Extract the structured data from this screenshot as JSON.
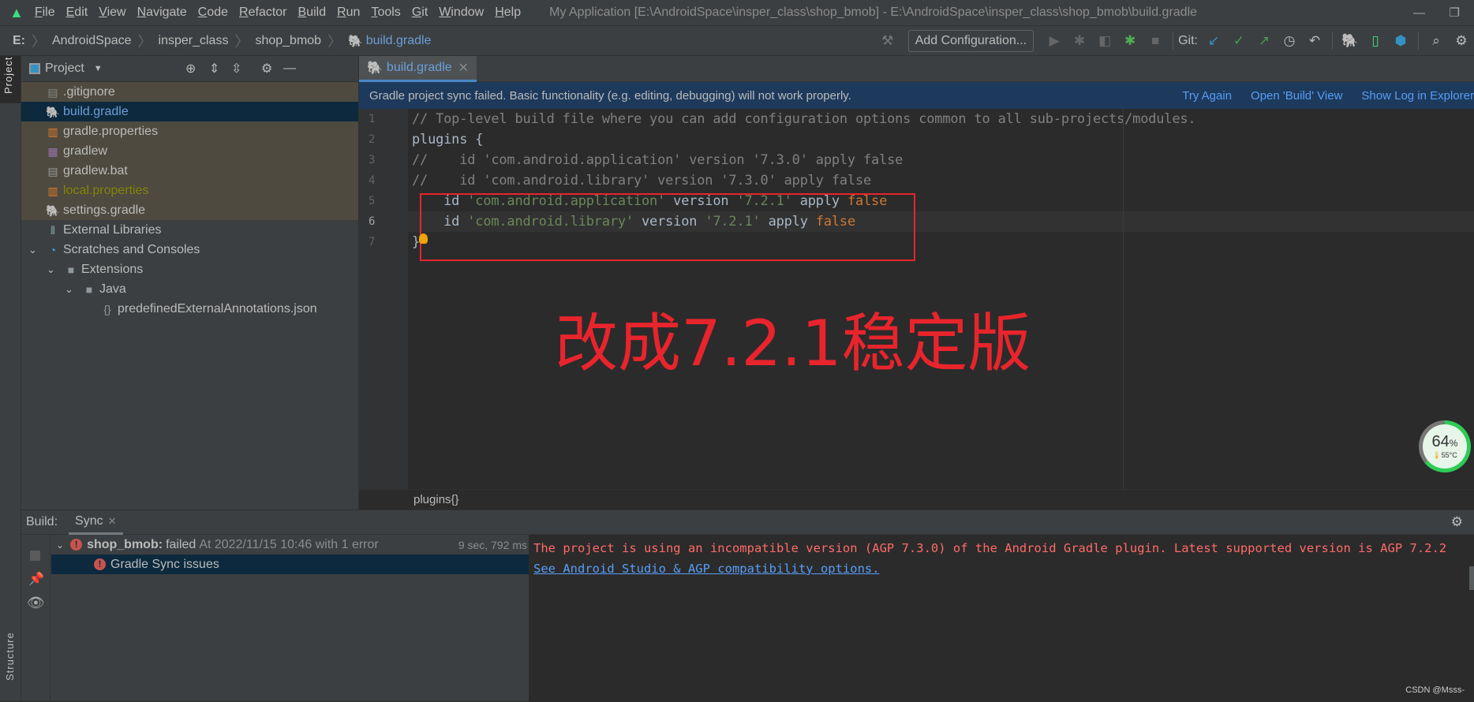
{
  "titlebar": {
    "menus": [
      "File",
      "Edit",
      "View",
      "Navigate",
      "Code",
      "Refactor",
      "Build",
      "Run",
      "Tools",
      "Git",
      "Window",
      "Help"
    ],
    "title": "My Application [E:\\AndroidSpace\\insper_class\\shop_bmob] - E:\\AndroidSpace\\insper_class\\shop_bmob\\build.gradle"
  },
  "navbar": {
    "breadcrumbs": [
      "E:",
      "AndroidSpace",
      "insper_class",
      "shop_bmob",
      "build.gradle"
    ],
    "add_config": "Add Configuration...",
    "git_label": "Git:"
  },
  "sidebar": {
    "project_tab": "Project",
    "structure_tab": "Structure"
  },
  "project": {
    "title": "Project",
    "items": [
      {
        "label": ".gitignore",
        "icon": "file-ignore-icon"
      },
      {
        "label": "build.gradle",
        "icon": "gradle-elephant-icon"
      },
      {
        "label": "gradle.properties",
        "icon": "properties-file-icon"
      },
      {
        "label": "gradlew",
        "icon": "shell-file-icon"
      },
      {
        "label": "gradlew.bat",
        "icon": "text-file-icon"
      },
      {
        "label": "local.properties",
        "icon": "properties-file-icon"
      },
      {
        "label": "settings.gradle",
        "icon": "gradle-elephant-icon"
      },
      {
        "label": "External Libraries",
        "icon": "libraries-icon"
      },
      {
        "label": "Scratches and Consoles",
        "icon": "scratches-icon"
      },
      {
        "label": "Extensions",
        "icon": "folder-icon"
      },
      {
        "label": "Java",
        "icon": "folder-icon"
      },
      {
        "label": "predefinedExternalAnnotations.json",
        "icon": "json-file-icon"
      }
    ]
  },
  "editor": {
    "tab": "build.gradle",
    "notification": {
      "text": "Gradle project sync failed. Basic functionality (e.g. editing, debugging) will not work properly.",
      "actions": [
        "Try Again",
        "Open 'Build' View",
        "Show Log in Explorer"
      ]
    },
    "lines": [
      {
        "n": "1",
        "parts": [
          [
            "cm",
            "// Top-level build file where you can add configuration options common to all sub-projects/modules."
          ]
        ]
      },
      {
        "n": "2",
        "parts": [
          [
            "",
            "plugins {"
          ]
        ]
      },
      {
        "n": "3",
        "parts": [
          [
            "cm",
            "//    id 'com.android.application' version '7.3.0' apply false"
          ]
        ]
      },
      {
        "n": "4",
        "parts": [
          [
            "cm",
            "//    id 'com.android.library' version '7.3.0' apply false"
          ]
        ]
      },
      {
        "n": "5",
        "parts": [
          [
            "",
            "    id "
          ],
          [
            "str",
            "'com.android.application'"
          ],
          [
            "",
            " version "
          ],
          [
            "str",
            "'7.2.1'"
          ],
          [
            "",
            " apply "
          ],
          [
            "kw",
            "false"
          ]
        ]
      },
      {
        "n": "6",
        "parts": [
          [
            "",
            "    id "
          ],
          [
            "str",
            "'com.android.library'"
          ],
          [
            "",
            " version "
          ],
          [
            "str",
            "'7.2.1'"
          ],
          [
            "",
            " apply "
          ],
          [
            "kw",
            "false"
          ]
        ]
      },
      {
        "n": "7",
        "parts": [
          [
            "",
            "}"
          ]
        ]
      }
    ],
    "annotation": "改成7.2.1稳定版",
    "breadcrumb": "plugins{}"
  },
  "battery": {
    "percent": "64",
    "unit": "%",
    "temp": "55°C",
    "level": 0.64
  },
  "build": {
    "label": "Build:",
    "tab": "Sync",
    "tree": [
      {
        "name": "shop_bmob:",
        "status": "failed",
        "detail": "At 2022/11/15 10:46 with 1 error",
        "time": "9 sec, 792 ms"
      },
      {
        "name": "Gradle Sync issues"
      }
    ],
    "console": {
      "error": "The project is using an incompatible version (AGP 7.3.0) of the Android Gradle plugin. Latest supported version is AGP 7.2.2",
      "link": "See Android Studio & AGP compatibility options."
    }
  },
  "watermark": "CSDN @Msss-",
  "colors": {
    "accent": "#589df6",
    "error": "#ff6b68",
    "annotation": "#e8242c"
  }
}
